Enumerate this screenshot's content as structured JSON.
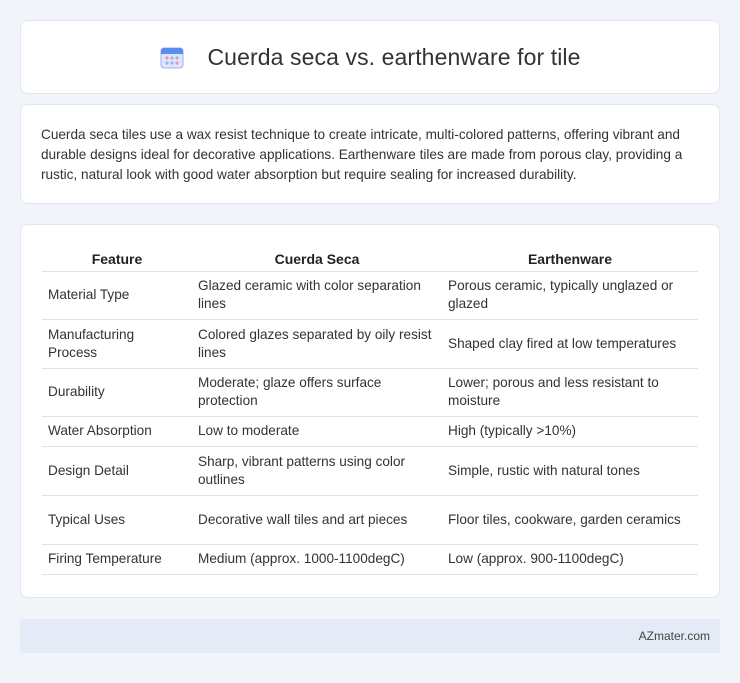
{
  "header": {
    "icon": "calendar-icon",
    "title": "Cuerda seca vs. earthenware for tile"
  },
  "intro": {
    "text": "Cuerda seca tiles use a wax resist technique to create intricate, multi-colored patterns, offering vibrant and durable designs ideal for decorative applications. Earthenware tiles are made from porous clay, providing a rustic, natural look with good water absorption but require sealing for increased durability."
  },
  "table": {
    "headers": [
      "Feature",
      "Cuerda Seca",
      "Earthenware"
    ],
    "rows": [
      [
        "Material Type",
        "Glazed ceramic with color separation lines",
        "Porous ceramic, typically unglazed or glazed"
      ],
      [
        "Manufacturing Process",
        "Colored glazes separated by oily resist lines",
        "Shaped clay fired at low temperatures"
      ],
      [
        "Durability",
        "Moderate; glaze offers surface protection",
        "Lower; porous and less resistant to moisture"
      ],
      [
        "Water Absorption",
        "Low to moderate",
        "High (typically >10%)"
      ],
      [
        "Design Detail",
        "Sharp, vibrant patterns using color outlines",
        "Simple, rustic with natural tones"
      ],
      [
        "Typical Uses",
        "Decorative wall tiles and art pieces",
        "Floor tiles, cookware, garden ceramics"
      ],
      [
        "Firing Temperature",
        "Medium (approx. 1000-1100degC)",
        "Low (approx. 900-1100degC)"
      ]
    ]
  },
  "footer": {
    "brand": "AZmater.com"
  },
  "colors": {
    "background": "#f1f4f9",
    "card": "#ffffff",
    "footer": "#e5ebf6",
    "icon_blue": "#5b8dee",
    "icon_pink": "#f48fb1"
  }
}
